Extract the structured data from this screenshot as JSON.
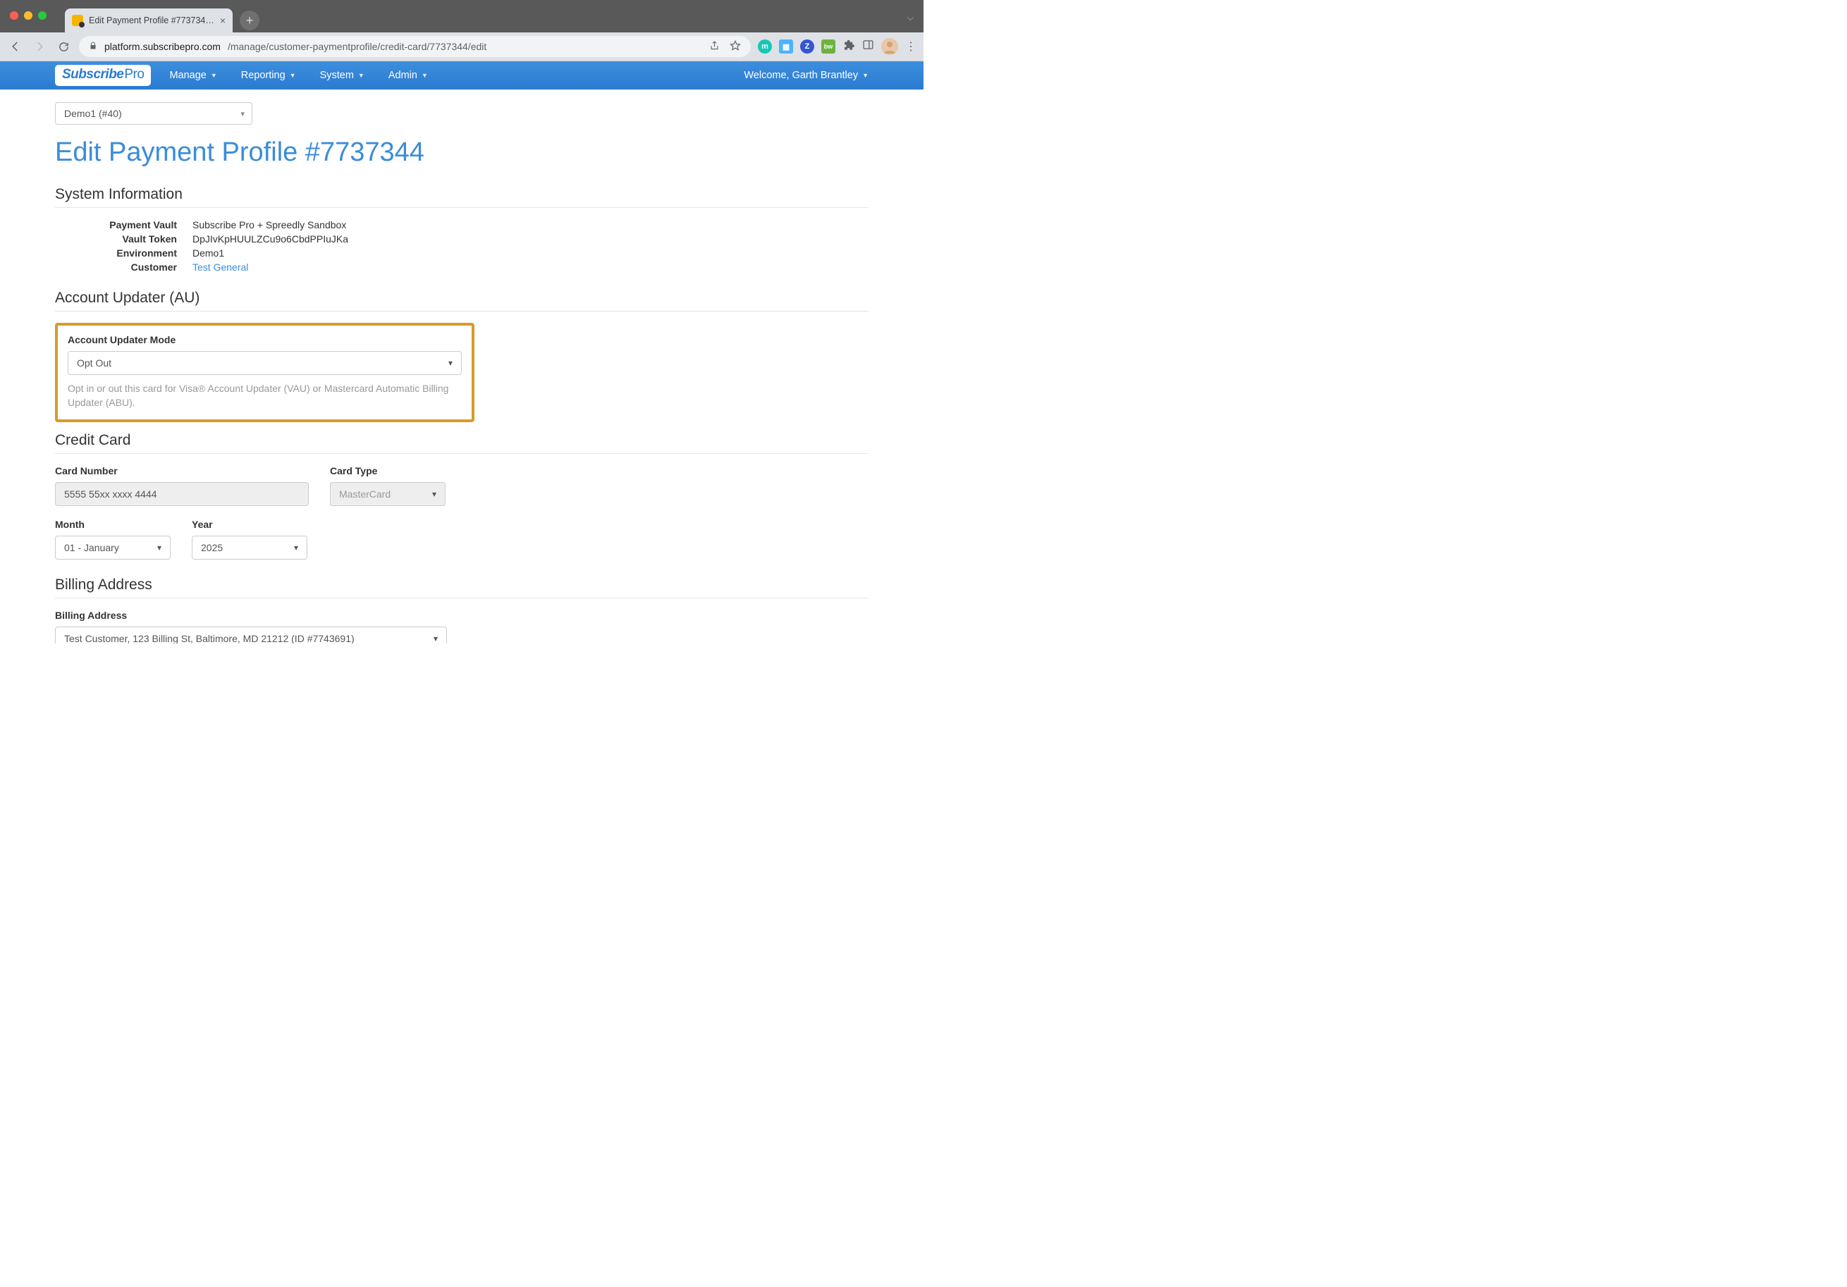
{
  "browser": {
    "tab_title": "Edit Payment Profile #773734…",
    "url_root": "platform.subscribepro.com",
    "url_path": "/manage/customer-paymentprofile/credit-card/7737344/edit"
  },
  "navbar": {
    "logo_main": "Subscribe",
    "logo_suffix": "Pro",
    "items": [
      "Manage",
      "Reporting",
      "System",
      "Admin"
    ],
    "welcome": "Welcome, Garth Brantley"
  },
  "env_selector": "Demo1 (#40)",
  "page_title": "Edit Payment Profile #7737344",
  "sections": {
    "system_info": {
      "title": "System Information",
      "rows": [
        {
          "label": "Payment Vault",
          "value": "Subscribe Pro + Spreedly Sandbox"
        },
        {
          "label": "Vault Token",
          "value": "DpJIvKpHUULZCu9o6CbdPPIuJKa"
        },
        {
          "label": "Environment",
          "value": "Demo1"
        },
        {
          "label": "Customer",
          "value": "Test General",
          "link": true
        }
      ]
    },
    "account_updater": {
      "title": "Account Updater (AU)",
      "field_label": "Account Updater Mode",
      "selected": "Opt Out",
      "help": "Opt in or out this card for Visa® Account Updater (VAU) or Mastercard Automatic Billing Updater (ABU)."
    },
    "credit_card": {
      "title": "Credit Card",
      "card_number_label": "Card Number",
      "card_number": "5555 55xx xxxx 4444",
      "card_type_label": "Card Type",
      "card_type": "MasterCard",
      "month_label": "Month",
      "month": "01 - January",
      "year_label": "Year",
      "year": "2025"
    },
    "billing": {
      "title": "Billing Address",
      "field_label": "Billing Address",
      "selected": "Test Customer, 123 Billing St, Baltimore, MD 21212 (ID #7743691)"
    }
  }
}
